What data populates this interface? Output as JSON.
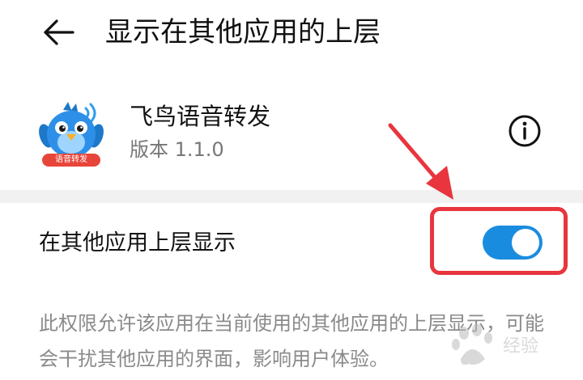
{
  "header": {
    "title": "显示在其他应用的上层",
    "back_icon": "arrow-left-icon"
  },
  "app": {
    "name": "飞鸟语音转发",
    "version": "版本 1.1.0",
    "icon": "blue-bird-app-icon",
    "icon_banner": "语音转发",
    "info_icon": "info-circle-icon"
  },
  "setting": {
    "label": "在其他应用上层显示",
    "enabled": true,
    "accent_color": "#1a8ce0"
  },
  "description": "此权限允许该应用在当前使用的其他应用的上层显示，可能会干扰其他应用的界面，影响用户体验。",
  "annotation": {
    "highlight_color": "#e8353e"
  },
  "watermark": {
    "text": "经验"
  }
}
